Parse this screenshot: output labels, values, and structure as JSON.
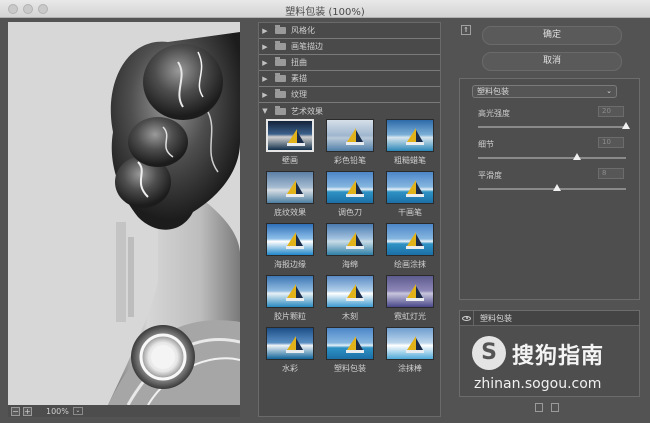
{
  "window": {
    "title": "塑料包装 (100%)"
  },
  "preview": {
    "zoom_value": "100%",
    "zoom_out": "−",
    "zoom_in": "+",
    "dropdown": "⌄"
  },
  "gallery": {
    "folders": [
      {
        "label": "风格化",
        "expanded": false,
        "arrow": "▶"
      },
      {
        "label": "画笔描边",
        "expanded": false,
        "arrow": "▶"
      },
      {
        "label": "扭曲",
        "expanded": false,
        "arrow": "▶"
      },
      {
        "label": "素描",
        "expanded": false,
        "arrow": "▶"
      },
      {
        "label": "纹理",
        "expanded": false,
        "arrow": "▶"
      },
      {
        "label": "艺术效果",
        "expanded": true,
        "arrow": "▼"
      }
    ],
    "filters": [
      "壁画",
      "彩色铅笔",
      "粗糙蜡笔",
      "底纹效果",
      "调色刀",
      "干画笔",
      "海报边缘",
      "海绵",
      "绘画涂抹",
      "胶片颗粒",
      "木刻",
      "霓虹灯光",
      "水彩",
      "塑料包装",
      "涂抹棒"
    ],
    "selected_filter": "塑料包装"
  },
  "right_panel": {
    "collapse_icon": "⇑",
    "ok_label": "确定",
    "cancel_label": "取消",
    "filter_select": {
      "value": "塑料包装",
      "arrow": "⌄"
    },
    "params": [
      {
        "label": "高光强度",
        "value": "20",
        "fraction": 1.0
      },
      {
        "label": "细节",
        "value": "10",
        "fraction": 0.667
      },
      {
        "label": "平滑度",
        "value": "8",
        "fraction": 0.533
      }
    ]
  },
  "layers": {
    "items": [
      {
        "name": "塑料包装",
        "visible": true
      }
    ]
  },
  "watermark": {
    "logo": "S",
    "text": "搜狗指南",
    "url": "zhinan.sogou.com"
  }
}
